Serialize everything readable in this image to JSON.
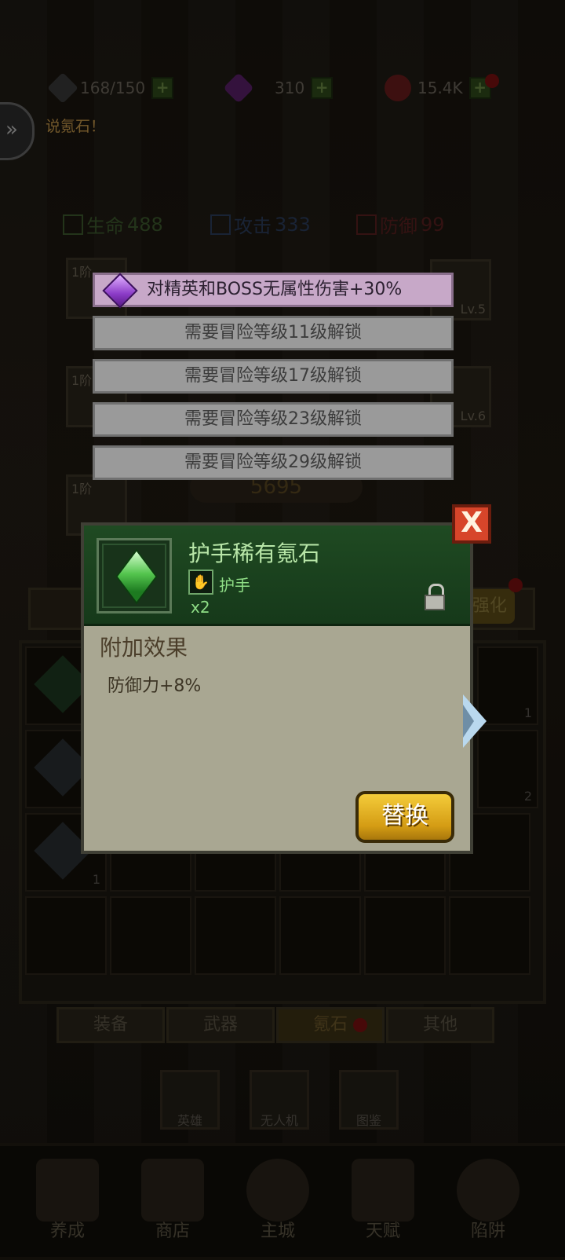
{
  "resources": {
    "stamina": "168/150",
    "gems": "310",
    "gold": "15.4K"
  },
  "dialog": {
    "text": "说氪石！"
  },
  "stats": {
    "hp_label": "生命",
    "hp_value": "488",
    "atk_label": "攻击",
    "atk_value": "333",
    "def_label": "防御",
    "def_value": "99"
  },
  "equip_slots": {
    "tier": "1阶",
    "levels": [
      "Lv.5",
      "Lv.6"
    ]
  },
  "power": "5695",
  "strengthen_label": "强化",
  "options": [
    {
      "label": "对精英和BOSS无属性伤害+30%",
      "active": true
    },
    {
      "label": "需要冒险等级11级解锁",
      "active": false
    },
    {
      "label": "需要冒险等级17级解锁",
      "active": false
    },
    {
      "label": "需要冒险等级23级解锁",
      "active": false
    },
    {
      "label": "需要冒险等级29级解锁",
      "active": false
    }
  ],
  "popup": {
    "item_name": "护手稀有氪石",
    "slot_name": "护手",
    "quantity": "x2",
    "section_title": "附加效果",
    "effect": "防御力+8%",
    "replace_button": "替换",
    "close_label": "X"
  },
  "inventory_counts": [
    "1",
    "2",
    "1"
  ],
  "category_tabs": [
    "装备",
    "武器",
    "氪石",
    "其他"
  ],
  "active_tab": "氪石",
  "features": [
    "英雄",
    "无人机",
    "图鉴"
  ],
  "bottom_nav": [
    "养成",
    "商店",
    "主城",
    "天赋",
    "陷阱"
  ],
  "colors": {
    "accent_gold": "#d49c14",
    "header_green": "#1f4a22",
    "close_red": "#d7452a",
    "option_active": "#c7a8c8"
  }
}
